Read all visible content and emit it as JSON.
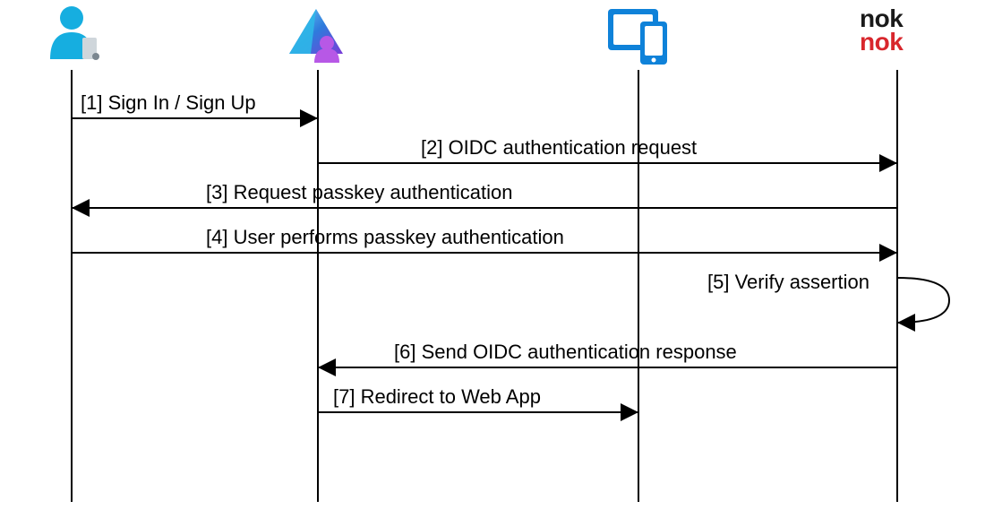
{
  "diagram": {
    "participants": {
      "user": {
        "name": "user-icon"
      },
      "idp": {
        "name": "idp-icon"
      },
      "device": {
        "name": "device-icon"
      },
      "noknok": {
        "line1": "nok",
        "line2": "nok"
      }
    },
    "messages": {
      "m1": "[1] Sign In / Sign Up",
      "m2": "[2] OIDC authentication request",
      "m3": "[3] Request passkey authentication",
      "m4": "[4] User performs passkey authentication",
      "m5": "[5] Verify assertion",
      "m6": "[6] Send OIDC authentication response",
      "m7": "[7] Redirect to Web App"
    }
  },
  "chart_data": {
    "type": "sequence-diagram",
    "title": "",
    "participants": [
      "User",
      "Identity Provider",
      "Device/App",
      "Nok Nok"
    ],
    "messages": [
      {
        "n": 1,
        "from": "User",
        "to": "Identity Provider",
        "label": "Sign In / Sign Up"
      },
      {
        "n": 2,
        "from": "Identity Provider",
        "to": "Nok Nok",
        "label": "OIDC authentication request"
      },
      {
        "n": 3,
        "from": "Nok Nok",
        "to": "User",
        "label": "Request passkey authentication"
      },
      {
        "n": 4,
        "from": "User",
        "to": "Nok Nok",
        "label": "User performs passkey authentication"
      },
      {
        "n": 5,
        "from": "Nok Nok",
        "to": "Nok Nok",
        "label": "Verify assertion"
      },
      {
        "n": 6,
        "from": "Nok Nok",
        "to": "Identity Provider",
        "label": "Send OIDC authentication response"
      },
      {
        "n": 7,
        "from": "Identity Provider",
        "to": "Device/App",
        "label": "Redirect to Web App"
      }
    ]
  }
}
